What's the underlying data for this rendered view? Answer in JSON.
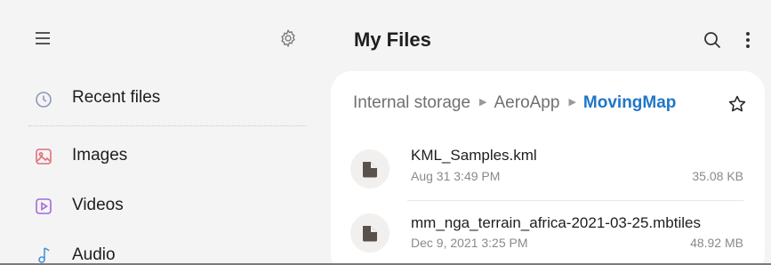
{
  "drawer": {
    "items": [
      {
        "label": "Recent files",
        "icon": "clock-icon",
        "color": "#8a98b8"
      },
      {
        "label": "Images",
        "icon": "image-icon",
        "color": "#e0707a"
      },
      {
        "label": "Videos",
        "icon": "video-icon",
        "color": "#a06ad8"
      },
      {
        "label": "Audio",
        "icon": "music-note-icon",
        "color": "#4a90e2"
      }
    ]
  },
  "header": {
    "title": "My Files"
  },
  "breadcrumb": {
    "items": [
      "Internal storage",
      "AeroApp",
      "MovingMap"
    ],
    "separator": "▶",
    "current_color": "#2176c7"
  },
  "files": [
    {
      "name": "KML_Samples.kml",
      "date": "Aug 31 3:49 PM",
      "size": "35.08 KB"
    },
    {
      "name": "mm_nga_terrain_africa-2021-03-25.mbtiles",
      "date": "Dec 9, 2021 3:25 PM",
      "size": "48.92 MB"
    }
  ]
}
